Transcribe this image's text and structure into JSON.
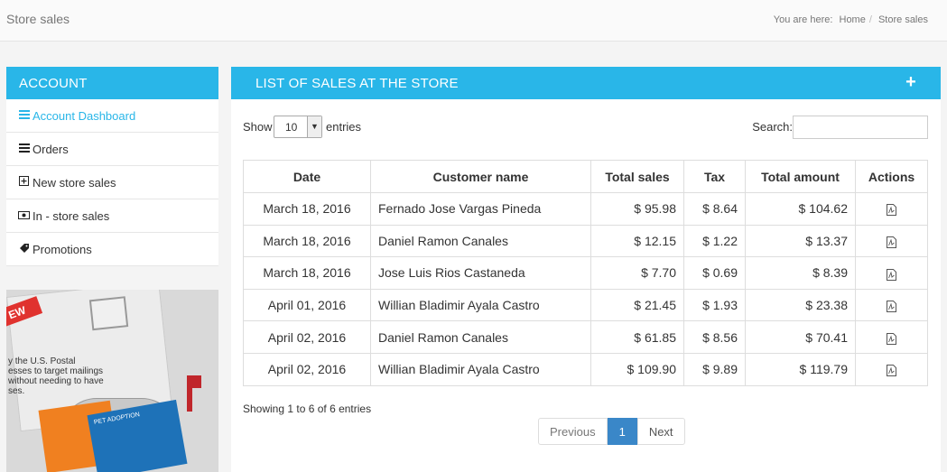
{
  "header": {
    "title": "Store sales",
    "breadcrumb": {
      "prefix": "You are here:",
      "home": "Home",
      "current": "Store sales",
      "separator": "/"
    }
  },
  "sidebar": {
    "heading": "ACCOUNT",
    "items": [
      {
        "label": "Account Dashboard",
        "icon": "list-icon",
        "active": true
      },
      {
        "label": "Orders",
        "icon": "list-icon"
      },
      {
        "label": "New store sales",
        "icon": "plus-square-icon"
      },
      {
        "label": "In - store sales",
        "icon": "money-icon"
      },
      {
        "label": "Promotions",
        "icon": "tag-icon"
      }
    ]
  },
  "promo": {
    "badge": "EW",
    "text": "y the U.S. Postal\nesses to target mailings\nwithout needing to have\nses.",
    "magazine_text": "PET ADOPTION",
    "colors": {
      "badge": "#e0322e",
      "flag": "#c0262b"
    }
  },
  "panel": {
    "heading": "LIST OF SALES AT THE STORE",
    "add_icon": "plus-icon",
    "show_label": "Show",
    "page_length": "10",
    "entries_label": "entries",
    "search_label": "Search:",
    "search_value": "",
    "columns": [
      "Date",
      "Customer name",
      "Total sales",
      "Tax",
      "Total amount",
      "Actions"
    ],
    "rows": [
      {
        "date": "March 18, 2016",
        "customer": "Fernado Jose Vargas Pineda",
        "total_sales": "$ 95.98",
        "tax": "$ 8.64",
        "total_amount": "$ 104.62"
      },
      {
        "date": "March 18, 2016",
        "customer": "Daniel Ramon Canales",
        "total_sales": "$ 12.15",
        "tax": "$ 1.22",
        "total_amount": "$ 13.37"
      },
      {
        "date": "March 18, 2016",
        "customer": "Jose Luis Rios Castaneda",
        "total_sales": "$ 7.70",
        "tax": "$ 0.69",
        "total_amount": "$ 8.39"
      },
      {
        "date": "April 01, 2016",
        "customer": "Willian Bladimir Ayala Castro",
        "total_sales": "$ 21.45",
        "tax": "$ 1.93",
        "total_amount": "$ 23.38"
      },
      {
        "date": "April 02, 2016",
        "customer": "Daniel Ramon Canales",
        "total_sales": "$ 61.85",
        "tax": "$ 8.56",
        "total_amount": "$ 70.41"
      },
      {
        "date": "April 02, 2016",
        "customer": "Willian Bladimir Ayala Castro",
        "total_sales": "$ 109.90",
        "tax": "$ 9.89",
        "total_amount": "$ 119.79"
      }
    ],
    "action_icon": "pdf-icon",
    "info": "Showing 1 to 6 of 6 entries",
    "pagination": {
      "previous": "Previous",
      "current": "1",
      "next": "Next"
    }
  },
  "colors": {
    "accent": "#29b6e8",
    "pager_active": "#3a87c8"
  }
}
